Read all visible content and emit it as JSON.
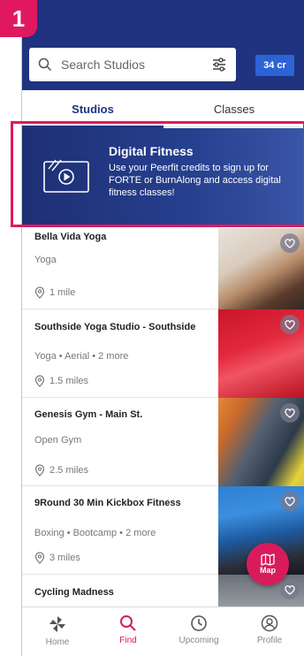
{
  "step_number": "1",
  "search": {
    "placeholder": "Search Studios",
    "credits": "34 cr"
  },
  "tabs": [
    {
      "label": "Studios",
      "active": true
    },
    {
      "label": "Classes",
      "active": false
    }
  ],
  "banner": {
    "title": "Digital Fitness",
    "text": "Use your Peerfit credits to sign up for FORTE or BurnAlong and access digital fitness classes!"
  },
  "studios": [
    {
      "name": "Bella Vida Yoga",
      "category": "Yoga",
      "distance": "1 mile"
    },
    {
      "name": "Southside Yoga Studio - Southside",
      "category": "Yoga • Aerial • 2 more",
      "distance": "1.5 miles"
    },
    {
      "name": "Genesis Gym - Main St.",
      "category": "Open Gym",
      "distance": "2.5 miles"
    },
    {
      "name": "9Round 30 Min Kickbox Fitness",
      "category": "Boxing • Bootcamp • 2 more",
      "distance": "3 miles"
    },
    {
      "name": "Cycling Madness"
    }
  ],
  "map_button": {
    "label": "Map"
  },
  "nav": [
    {
      "label": "Home",
      "icon": "pinwheel-icon",
      "active": false
    },
    {
      "label": "Find",
      "icon": "search-icon",
      "active": true
    },
    {
      "label": "Upcoming",
      "icon": "clock-icon",
      "active": false
    },
    {
      "label": "Profile",
      "icon": "user-icon",
      "active": false
    }
  ],
  "colors": {
    "brand_navy": "#1f3380",
    "accent_pink": "#d81b5c",
    "credits_blue": "#2c63d6",
    "highlight": "#e0195f"
  }
}
